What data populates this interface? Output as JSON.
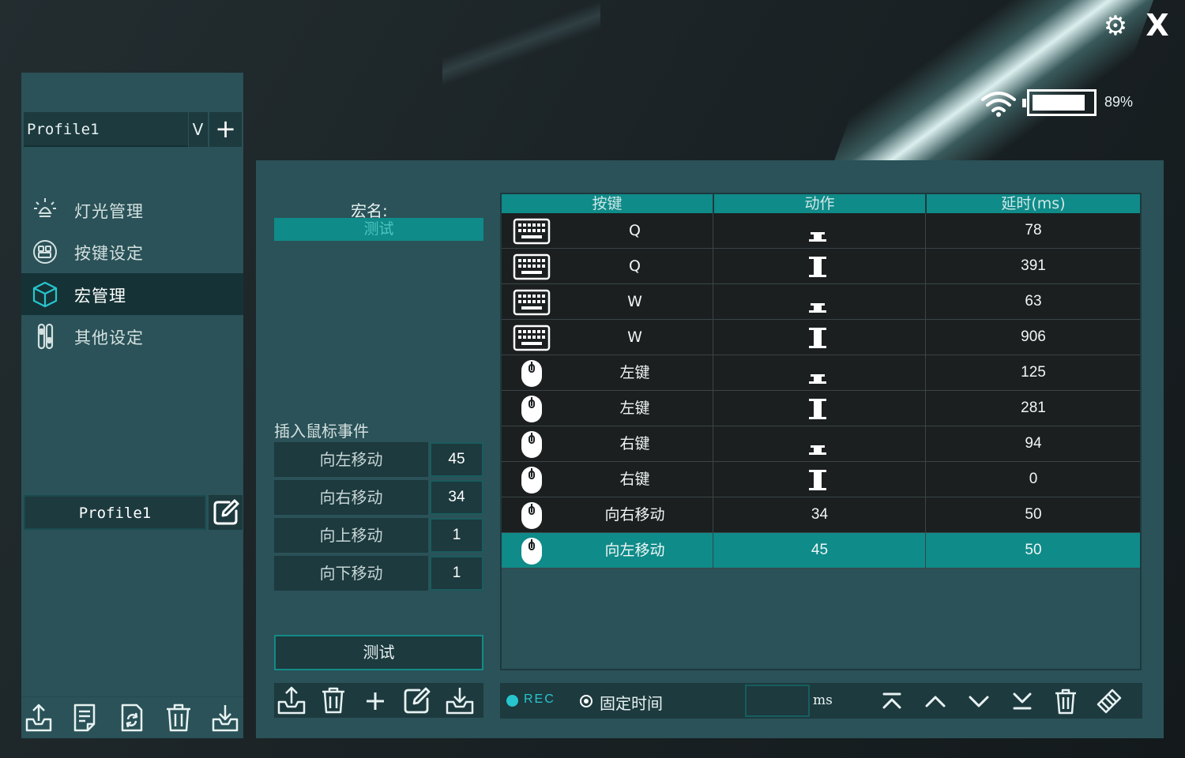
{
  "window": {
    "settings_icon": "gear-icon",
    "close_label": "X"
  },
  "status": {
    "battery_level": 0.89,
    "battery_text": "89%",
    "wifi_icon": "wifi-icon"
  },
  "sidebar": {
    "profile_select": "Profile1",
    "dropdown_label": "V",
    "add_label": "+",
    "nav": [
      {
        "label": "灯光管理",
        "icon": "light-bulb-icon"
      },
      {
        "label": "按键设定",
        "icon": "keypad-icon"
      },
      {
        "label": "宏管理",
        "icon": "cube-icon"
      },
      {
        "label": "其他设定",
        "icon": "sliders-icon"
      }
    ],
    "active_nav": "宏管理",
    "profile_name": "Profile1",
    "bottom_tools": [
      "export-icon",
      "notes-icon",
      "refresh-file-icon",
      "trash-icon",
      "import-icon"
    ]
  },
  "macro": {
    "name_label": "宏名:",
    "name_value": "测试",
    "insert_label": "插入鼠标事件",
    "mouse_events": [
      {
        "label": "向左移动",
        "value": "45"
      },
      {
        "label": "向右移动",
        "value": "34"
      },
      {
        "label": "向上移动",
        "value": "1"
      },
      {
        "label": "向下移动",
        "value": "1"
      }
    ],
    "test_label": "测试",
    "left_tools": [
      "export-icon",
      "trash-icon",
      "plus-icon",
      "edit-icon",
      "import-icon"
    ]
  },
  "table": {
    "headers": [
      "按键",
      "动作",
      "延时(ms)"
    ],
    "rows": [
      {
        "device": "keyboard",
        "key": "Q",
        "action": "release",
        "delay": "78"
      },
      {
        "device": "keyboard",
        "key": "Q",
        "action": "press",
        "delay": "391"
      },
      {
        "device": "keyboard",
        "key": "W",
        "action": "release",
        "delay": "63"
      },
      {
        "device": "keyboard",
        "key": "W",
        "action": "press",
        "delay": "906"
      },
      {
        "device": "mouse",
        "key": "左键",
        "action": "release",
        "delay": "125"
      },
      {
        "device": "mouse",
        "key": "左键",
        "action": "press",
        "delay": "281"
      },
      {
        "device": "mouse",
        "key": "右键",
        "action": "release",
        "delay": "94"
      },
      {
        "device": "mouse",
        "key": "右键",
        "action": "press",
        "delay": "0"
      },
      {
        "device": "mouse",
        "key": "向右移动",
        "action": "34",
        "delay": "50"
      },
      {
        "device": "mouse",
        "key": "向左移动",
        "action": "45",
        "delay": "50"
      }
    ],
    "selected_row": 9
  },
  "bottom_bar": {
    "rec_label": "REC",
    "fixed_time_label": "固定时间",
    "ms_value": "",
    "ms_unit": "ms",
    "tools": [
      "move-top-icon",
      "move-up-icon",
      "move-down-icon",
      "move-bottom-icon",
      "trash-icon",
      "clear-icon"
    ]
  },
  "colors": {
    "accent": "#0f8b89",
    "panel": "#2a5258",
    "dark_field": "#1d3a3e",
    "rec": "#27c6cf"
  }
}
